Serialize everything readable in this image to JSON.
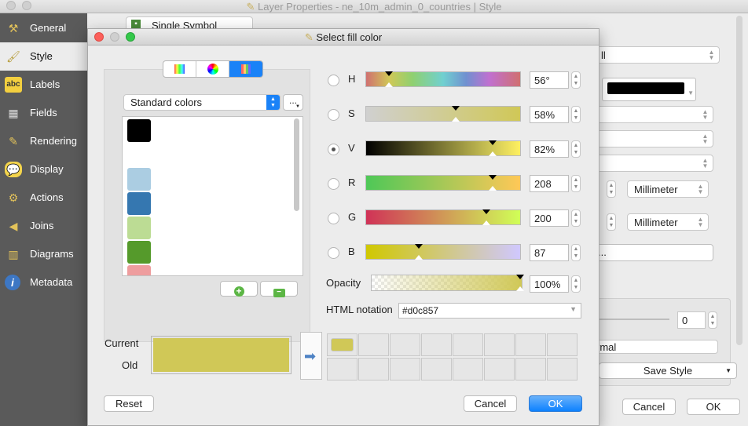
{
  "main_window": {
    "title": "Layer Properties - ne_10m_admin_0_countries | Style",
    "symbol_type": "Single Symbol",
    "sidebar": [
      {
        "label": "General",
        "icon": "tools-icon"
      },
      {
        "label": "Style",
        "icon": "brush-icon",
        "selected": true
      },
      {
        "label": "Labels",
        "icon": "abc-icon"
      },
      {
        "label": "Fields",
        "icon": "table-icon"
      },
      {
        "label": "Rendering",
        "icon": "paintbrush-icon"
      },
      {
        "label": "Display",
        "icon": "speech-bubble-icon"
      },
      {
        "label": "Actions",
        "icon": "gear-icon"
      },
      {
        "label": "Joins",
        "icon": "joins-icon"
      },
      {
        "label": "Diagrams",
        "icon": "diagram-icon"
      },
      {
        "label": "Metadata",
        "icon": "info-icon"
      }
    ],
    "fill_combo": "ll",
    "unit1": "Millimeter",
    "unit2": "Millimeter",
    "offset_value": "0",
    "blend_partial": "rmal",
    "ellipsis_partial": "...",
    "save_style": "Save Style",
    "cancel": "Cancel",
    "ok": "OK",
    "outline_color": "#000000"
  },
  "dialog": {
    "title": "Select fill color",
    "palette_combo": "Standard colors",
    "palette_menu": "...",
    "palette_colors": [
      "#000000",
      "#ffffff",
      "#abcde2",
      "#3577b0",
      "#bcdc94",
      "#559a2b",
      "#ee9d9e"
    ],
    "channels": [
      {
        "label": "H",
        "value": "56°",
        "fraction": 0.15,
        "checked": false
      },
      {
        "label": "S",
        "value": "58%",
        "fraction": 0.58,
        "checked": false
      },
      {
        "label": "V",
        "value": "82%",
        "fraction": 0.82,
        "checked": true
      },
      {
        "label": "R",
        "value": "208",
        "fraction": 0.82,
        "checked": false
      },
      {
        "label": "G",
        "value": "200",
        "fraction": 0.78,
        "checked": false
      },
      {
        "label": "B",
        "value": "87",
        "fraction": 0.34,
        "checked": false
      }
    ],
    "opacity_label": "Opacity",
    "opacity_value": "100%",
    "html_label": "HTML notation",
    "html_value": "#d0c857",
    "current_label": "Current",
    "old_label": "Old",
    "current_color": "#d0c857",
    "old_color": "#d0c857",
    "reset": "Reset",
    "cancel": "Cancel",
    "ok": "OK",
    "accent": "#1a82f7"
  }
}
